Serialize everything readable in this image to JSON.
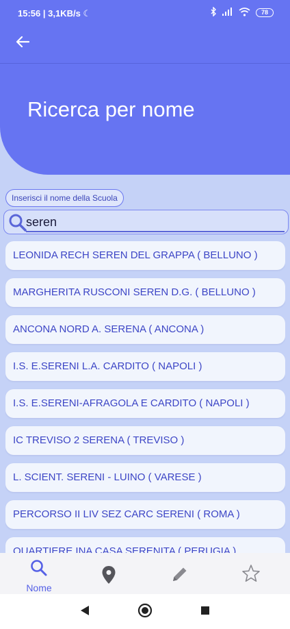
{
  "status_bar": {
    "time": "15:56 | 3,1KB/s ☾",
    "battery": "78"
  },
  "header": {
    "title": "Ricerca per nome"
  },
  "search": {
    "label": "Inserisci il nome della Scuola",
    "value": "seren"
  },
  "results": [
    "LEONIDA RECH SEREN DEL GRAPPA  ( BELLUNO )",
    "MARGHERITA RUSCONI SEREN D.G.  ( BELLUNO )",
    "ANCONA NORD A. SERENA  ( ANCONA )",
    "I.S. E.SERENI L.A. CARDITO  ( NAPOLI )",
    "I.S. E.SERENI-AFRAGOLA E CARDITO  ( NAPOLI )",
    "IC TREVISO 2 SERENA  ( TREVISO )",
    "L. SCIENT. SERENI - LUINO  ( VARESE )",
    "PERCORSO II LIV SEZ CARC SERENI  ( ROMA )",
    "QUARTIERE INA CASA SERENITA  ( PERUGIA )"
  ],
  "bottom_nav": {
    "items": [
      {
        "icon": "search-icon",
        "label": "Nome",
        "active": true
      },
      {
        "icon": "location-pin-icon",
        "label": "",
        "active": false
      },
      {
        "icon": "pencil-icon",
        "label": "",
        "active": false
      },
      {
        "icon": "star-icon",
        "label": "",
        "active": false
      }
    ]
  },
  "colors": {
    "accent": "#6674f2",
    "background": "#c5d2f7",
    "result_text": "#3d46c6"
  }
}
